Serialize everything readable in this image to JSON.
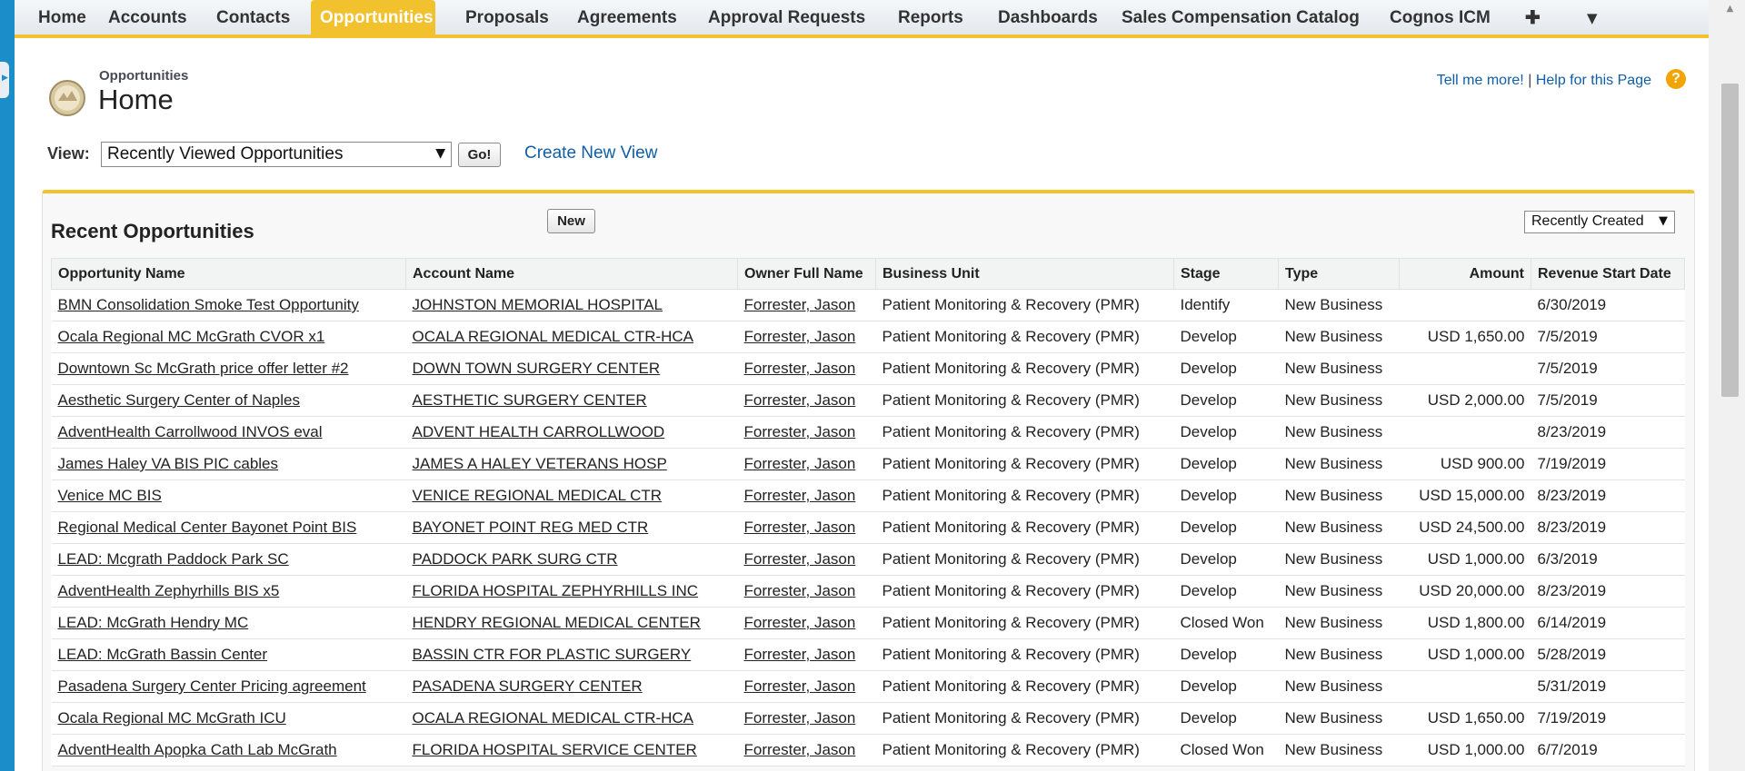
{
  "nav": {
    "tabs": [
      "Home",
      "Accounts",
      "Contacts",
      "Opportunities",
      "Proposals",
      "Agreements",
      "Approval Requests",
      "Reports",
      "Dashboards",
      "Sales Compensation Catalog",
      "Cognos ICM"
    ],
    "active_tab": "Opportunities",
    "add_tab_icon": "plus-icon",
    "more_tabs_icon": "chevron-down-icon"
  },
  "header": {
    "breadcrumb": "Opportunities",
    "title": "Home",
    "tell_me_more": "Tell me more!",
    "separator": "|",
    "help_link": "Help for this Page",
    "help_icon": "?"
  },
  "view": {
    "label": "View:",
    "selected": "Recently Viewed Opportunities",
    "go_label": "Go!",
    "create_view": "Create New View"
  },
  "recent": {
    "title": "Recent Opportunities",
    "new_label": "New",
    "sort_selected": "Recently Created",
    "columns": [
      "Opportunity Name",
      "Account Name",
      "Owner Full Name",
      "Business Unit",
      "Stage",
      "Type",
      "Amount",
      "Revenue Start Date"
    ],
    "rows": [
      [
        "BMN Consolidation Smoke Test Opportunity",
        "JOHNSTON MEMORIAL HOSPITAL",
        "Forrester, Jason",
        "Patient Monitoring & Recovery (PMR)",
        "Identify",
        "New Business",
        "",
        "6/30/2019"
      ],
      [
        "Ocala Regional MC McGrath CVOR x1",
        "OCALA REGIONAL MEDICAL CTR-HCA",
        "Forrester, Jason",
        "Patient Monitoring & Recovery (PMR)",
        "Develop",
        "New Business",
        "USD 1,650.00",
        "7/5/2019"
      ],
      [
        "Downtown Sc McGrath price offer letter #2",
        "DOWN TOWN SURGERY CENTER",
        "Forrester, Jason",
        "Patient Monitoring & Recovery (PMR)",
        "Develop",
        "New Business",
        "",
        "7/5/2019"
      ],
      [
        "Aesthetic Surgery Center of Naples",
        "AESTHETIC SURGERY CENTER",
        "Forrester, Jason",
        "Patient Monitoring & Recovery (PMR)",
        "Develop",
        "New Business",
        "USD 2,000.00",
        "7/5/2019"
      ],
      [
        "AdventHealth Carrollwood INVOS eval",
        "ADVENT HEALTH CARROLLWOOD",
        "Forrester, Jason",
        "Patient Monitoring & Recovery (PMR)",
        "Develop",
        "New Business",
        "",
        "8/23/2019"
      ],
      [
        "James Haley VA BIS PIC cables",
        "JAMES A HALEY VETERANS HOSP",
        "Forrester, Jason",
        "Patient Monitoring & Recovery (PMR)",
        "Develop",
        "New Business",
        "USD 900.00",
        "7/19/2019"
      ],
      [
        "Venice MC BIS",
        "VENICE REGIONAL MEDICAL CTR",
        "Forrester, Jason",
        "Patient Monitoring & Recovery (PMR)",
        "Develop",
        "New Business",
        "USD 15,000.00",
        "8/23/2019"
      ],
      [
        "Regional Medical Center Bayonet Point BIS",
        "BAYONET POINT REG MED CTR",
        "Forrester, Jason",
        "Patient Monitoring & Recovery (PMR)",
        "Develop",
        "New Business",
        "USD 24,500.00",
        "8/23/2019"
      ],
      [
        "LEAD: Mcgrath Paddock Park SC",
        "PADDOCK PARK SURG CTR",
        "Forrester, Jason",
        "Patient Monitoring & Recovery (PMR)",
        "Develop",
        "New Business",
        "USD 1,000.00",
        "6/3/2019"
      ],
      [
        "AdventHealth Zephyrhills BIS x5",
        "FLORIDA HOSPITAL ZEPHYRHILLS INC",
        "Forrester, Jason",
        "Patient Monitoring & Recovery (PMR)",
        "Develop",
        "New Business",
        "USD 20,000.00",
        "8/23/2019"
      ],
      [
        "LEAD: McGrath Hendry MC",
        "HENDRY REGIONAL MEDICAL CENTER",
        "Forrester, Jason",
        "Patient Monitoring & Recovery (PMR)",
        "Closed Won",
        "New Business",
        "USD 1,800.00",
        "6/14/2019"
      ],
      [
        "LEAD: McGrath Bassin Center",
        "BASSIN CTR FOR PLASTIC SURGERY",
        "Forrester, Jason",
        "Patient Monitoring & Recovery (PMR)",
        "Develop",
        "New Business",
        "USD 1,000.00",
        "5/28/2019"
      ],
      [
        "Pasadena Surgery Center Pricing agreement",
        "PASADENA SURGERY CENTER",
        "Forrester, Jason",
        "Patient Monitoring & Recovery (PMR)",
        "Develop",
        "New Business",
        "",
        "5/31/2019"
      ],
      [
        "Ocala Regional MC McGrath ICU",
        "OCALA REGIONAL MEDICAL CTR-HCA",
        "Forrester, Jason",
        "Patient Monitoring & Recovery (PMR)",
        "Develop",
        "New Business",
        "USD 1,650.00",
        "7/19/2019"
      ],
      [
        "AdventHealth Apopka Cath Lab McGrath",
        "FLORIDA HOSPITAL SERVICE CENTER",
        "Forrester, Jason",
        "Patient Monitoring & Recovery (PMR)",
        "Closed Won",
        "New Business",
        "USD 1,000.00",
        "6/7/2019"
      ]
    ]
  },
  "colors": {
    "accent": "#f2c12e",
    "link": "#0f5ea6",
    "frame": "#1b8ec9"
  }
}
